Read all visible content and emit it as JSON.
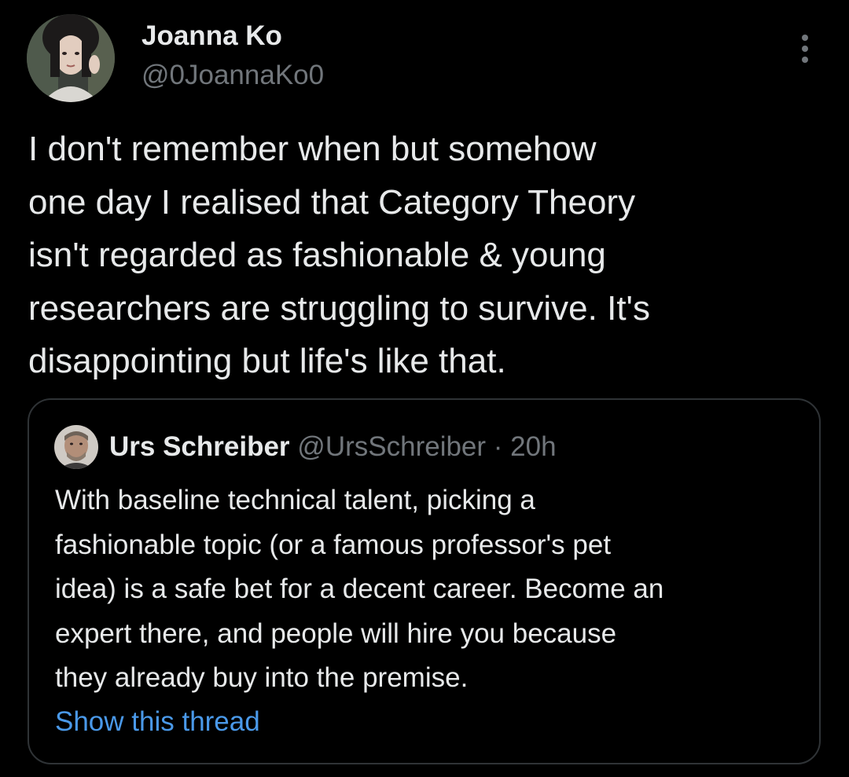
{
  "author": {
    "display_name": "Joanna Ko",
    "handle": "@0JoannaKo0"
  },
  "tweet": {
    "text": "I don't remember when but somehow\none day I realised that Category Theory\nisn't regarded as fashionable & young\nresearchers are struggling to survive. It's\ndisappointing but life's like that."
  },
  "quoted_tweet": {
    "display_name": "Urs Schreiber",
    "handle": "@UrsSchreiber",
    "separator": "·",
    "time": "20h",
    "text": "With baseline technical talent, picking a\nfashionable topic (or a famous professor's pet\nidea) is a safe bet for a decent career. Become an\nexpert there, and people will hire you because\nthey already buy into the premise.",
    "show_thread_label": "Show this thread"
  },
  "icons": {
    "more": "more-horizontal-icon"
  },
  "colors": {
    "background": "#000000",
    "primary_text": "#e7e9ea",
    "secondary_text": "#71767b",
    "link": "#4a99e9",
    "border": "#2f3336"
  }
}
